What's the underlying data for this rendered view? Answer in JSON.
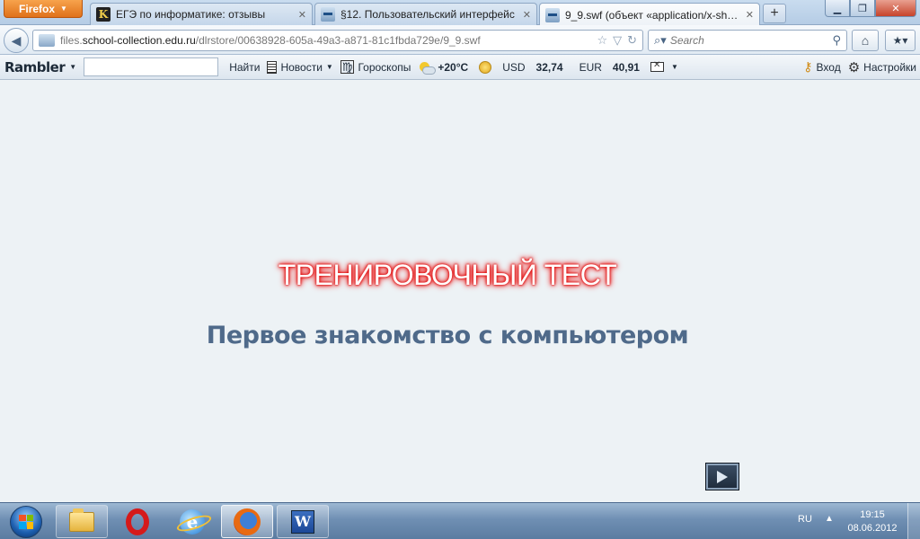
{
  "browser": {
    "menu_button": "Firefox",
    "tabs": [
      {
        "title": "ЕГЭ по информатике: отзывы",
        "icon": "k-favicon",
        "active": false
      },
      {
        "title": "§12. Пользовательский интерфейс",
        "icon": "swf-favicon",
        "active": false
      },
      {
        "title": "9_9.swf (объект «application/x-shock...",
        "icon": "swf-favicon",
        "active": true
      }
    ],
    "new_tab": "+",
    "url": {
      "prefix": "files.",
      "host": "school-collection.edu.ru",
      "path": "/dlrstore/00638928-605a-49a3-a871-81c1fbda729e/9_9.swf"
    },
    "search_placeholder": "Search"
  },
  "rambler_toolbar": {
    "logo": "Rambler",
    "search_value": "",
    "find_label": "Найти",
    "news_label": "Новости",
    "horoscope_label": "Гороскопы",
    "temperature": "+20°C",
    "usd_label": "USD",
    "usd_value": "32,74",
    "eur_label": "EUR",
    "eur_value": "40,91",
    "login_label": "Вход",
    "settings_label": "Настройки"
  },
  "content": {
    "title": "ТРЕНИРОВОЧНЫЙ ТЕСТ",
    "subtitle": "Первое знакомство с компьютером",
    "title_glow_color": "#e01010",
    "subtitle_color": "#4f6a8a"
  },
  "taskbar": {
    "apps": [
      "explorer",
      "opera",
      "internet-explorer",
      "firefox",
      "word"
    ],
    "language": "RU",
    "time": "19:15",
    "date": "08.06.2012"
  }
}
